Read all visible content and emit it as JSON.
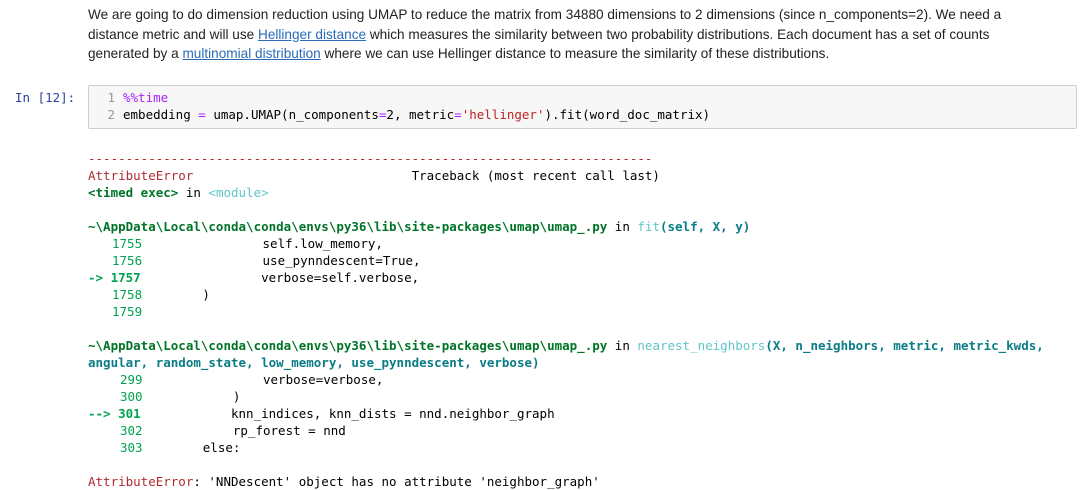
{
  "markdown": {
    "text_1": "We are going to do dimension reduction using UMAP to reduce the matrix from 34880 dimensions to 2 dimensions (since n_components=2). We need a distance metric and will use ",
    "link_1": "Hellinger distance",
    "text_2": " which measures the similarity between two probability distributions. Each document has a set of counts generated by a ",
    "link_2": "multinomial distribution",
    "text_3": " where we can use Hellinger distance to measure the similarity of these distributions."
  },
  "cell": {
    "prompt": "In [12]:",
    "lines": [
      {
        "num": "1",
        "magic": "%%time"
      },
      {
        "num": "2",
        "pre": "embedding ",
        "eq": "=",
        "mid": " umap.UMAP(n_components",
        "eq2": "=",
        "mid2": "2, metric",
        "eq3": "=",
        "str": "'hellinger'",
        "post": ").fit(word_doc_matrix)"
      }
    ]
  },
  "output": {
    "dashes": "---------------------------------------------------------------------------",
    "err_name": "AttributeError",
    "traceback_label": "Traceback (most recent call last)",
    "timed_exec": "<timed exec>",
    "in_word": " in ",
    "module": "<module>",
    "frame1_path": "~\\AppData\\Local\\conda\\conda\\envs\\py36\\lib\\site-packages\\umap\\umap_.py",
    "frame1_fn": "fit",
    "frame1_args": "(self, X, y)",
    "frame1_lines": [
      {
        "num": "1755",
        "arrow": "",
        "code": "                self.low_memory,"
      },
      {
        "num": "1756",
        "arrow": "",
        "code": "                use_pynndescent=True,"
      },
      {
        "num": "1757",
        "arrow": "-> ",
        "code": "                verbose=self.verbose,"
      },
      {
        "num": "1758",
        "arrow": "",
        "code": "        )"
      },
      {
        "num": "1759",
        "arrow": "",
        "code": ""
      }
    ],
    "frame2_path": "~\\AppData\\Local\\conda\\conda\\envs\\py36\\lib\\site-packages\\umap\\umap_.py",
    "frame2_fn": "nearest_neighbors",
    "frame2_args_1": "(X, n_neighbors, metric, metric_kwds,",
    "frame2_args_2": "angular, random_state, low_memory, use_pynndescent, verbose)",
    "frame2_lines": [
      {
        "num": "299",
        "arrow": "",
        "code": "                verbose=verbose,"
      },
      {
        "num": "300",
        "arrow": "",
        "code": "            )"
      },
      {
        "num": "301",
        "arrow": "--> ",
        "code": "            knn_indices, knn_dists = nnd.neighbor_graph"
      },
      {
        "num": "302",
        "arrow": "",
        "code": "            rp_forest = nnd"
      },
      {
        "num": "303",
        "arrow": "",
        "code": "        else:"
      }
    ],
    "final_err_name": "AttributeError",
    "final_err_msg": ": 'NNDescent' object has no attribute 'neighbor_graph'"
  }
}
